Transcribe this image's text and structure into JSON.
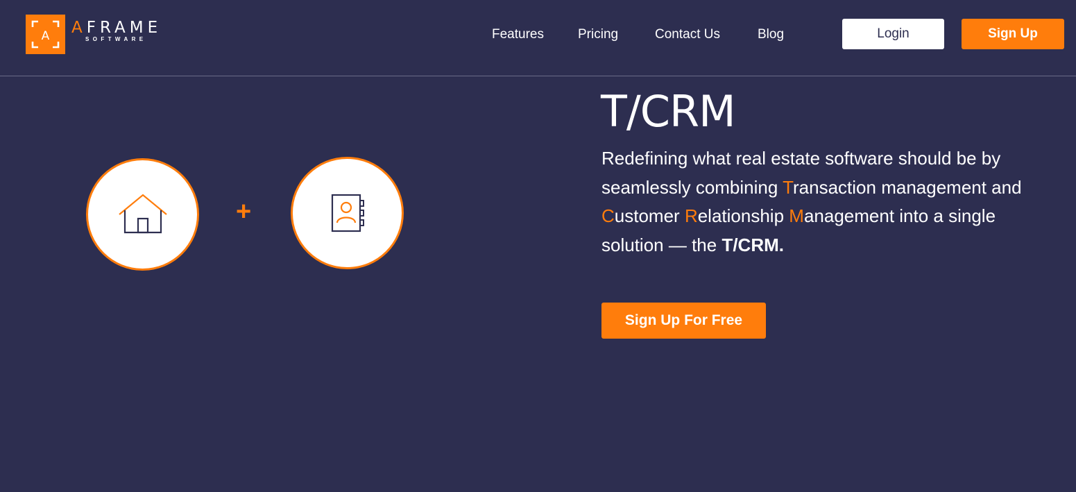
{
  "brand": {
    "mark_letter": "A",
    "word_first": "A",
    "word_rest": "FRAME",
    "subtitle": "SOFTWARE"
  },
  "nav": {
    "features": "Features",
    "pricing": "Pricing",
    "contact": "Contact Us",
    "blog": "Blog"
  },
  "header_buttons": {
    "login": "Login",
    "signup": "Sign Up"
  },
  "hero": {
    "title": "T/CRM",
    "plus": "+",
    "desc": {
      "p1": "Redefining what real estate software should be by seamlessly combining ",
      "t": "T",
      "p2": "ransaction management and ",
      "c": "C",
      "p3": "ustomer ",
      "r": "R",
      "p4": "elationship ",
      "m": "M",
      "p5": "anagement into a single solution — the ",
      "strong": "T/CRM."
    },
    "cta": "Sign Up For Free"
  },
  "icons": {
    "house": "house-icon",
    "contact_book": "contact-book-icon"
  },
  "colors": {
    "background": "#2d2e50",
    "accent": "#ff7d0c",
    "text": "#ffffff"
  }
}
